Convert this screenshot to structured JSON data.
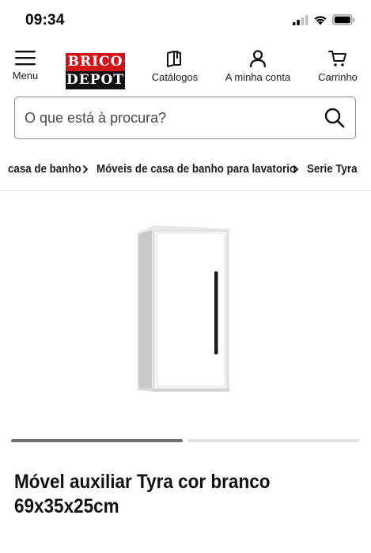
{
  "status_bar": {
    "time": "09:34"
  },
  "header": {
    "menu_label": "Menu",
    "logo_top": "BRICO",
    "logo_bottom": "DEPOT",
    "catalogs_label": "Catálogos",
    "account_label": "A minha conta",
    "cart_label": "Carrinho"
  },
  "search": {
    "placeholder": "O que está à procura?"
  },
  "breadcrumb": {
    "items": [
      "casa de banho",
      "Móveis de casa de banho para lavatorio",
      "Serie Tyra"
    ]
  },
  "carousel": {
    "active_index": 0,
    "count": 2
  },
  "product": {
    "title": "Móvel auxiliar Tyra cor branco 69x35x25cm"
  },
  "icons": {
    "menu": "hamburger-menu-icon",
    "catalogs": "book-icon",
    "account": "user-icon",
    "cart": "cart-icon",
    "search": "search-icon",
    "signal": "cellular-signal-icon",
    "wifi": "wifi-icon",
    "battery": "battery-icon"
  },
  "colors": {
    "brand_red": "#d3151a",
    "brand_black": "#111111",
    "carousel_active": "#6f706c",
    "carousel_inactive": "#e2e2e2"
  }
}
